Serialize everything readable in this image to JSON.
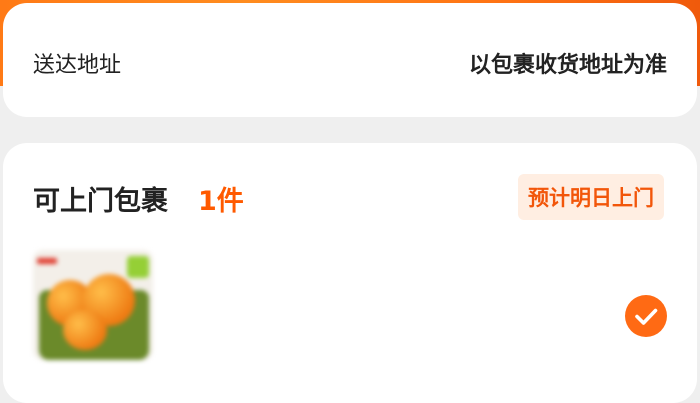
{
  "address": {
    "label": "送达地址",
    "value": "以包裹收货地址为准"
  },
  "parcel": {
    "title": "可上门包裹",
    "count": "1件",
    "eta_badge": "预计明日上门",
    "item": {
      "name": "",
      "thumb_icon": "product-thumbnail",
      "selected": true,
      "check_icon": "check-icon"
    }
  },
  "colors": {
    "accent": "#ff6a14",
    "count": "#ff5a00",
    "badge_bg": "#ffeee2",
    "badge_text": "#f2560a"
  }
}
